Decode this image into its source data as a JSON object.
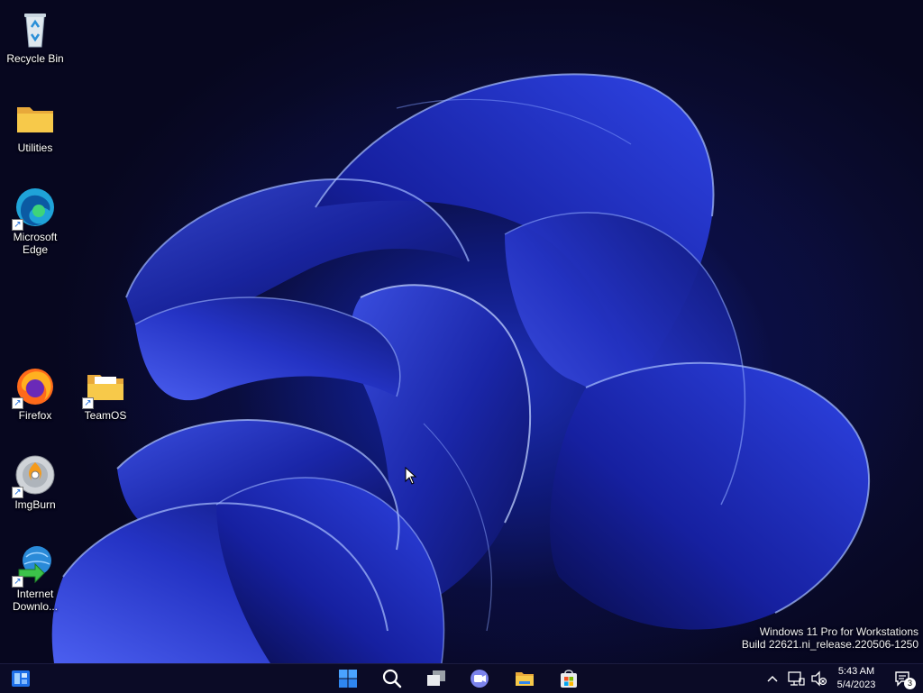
{
  "desktop": {
    "icons": [
      {
        "label": "Recycle Bin",
        "icon": "recycle-bin-icon"
      },
      {
        "label": "Utilities",
        "icon": "folder-icon"
      },
      {
        "label": "Microsoft\nEdge",
        "icon": "edge-icon"
      },
      {
        "label": "Firefox",
        "icon": "firefox-icon"
      },
      {
        "label": "TeamOS",
        "icon": "folder-icon"
      },
      {
        "label": "ImgBurn",
        "icon": "imgburn-icon"
      },
      {
        "label": "Internet\nDownlo...",
        "icon": "internet-download-manager-icon"
      }
    ],
    "watermark": {
      "line1": "Windows 11 Pro for Workstations",
      "line2": "Build 22621.ni_release.220506-1250"
    }
  },
  "taskbar": {
    "items": [
      {
        "name": "widgets",
        "icon": "widgets-icon"
      },
      {
        "name": "start",
        "icon": "windows-start-icon"
      },
      {
        "name": "search",
        "icon": "search-icon"
      },
      {
        "name": "task-view",
        "icon": "task-view-icon"
      },
      {
        "name": "teams-chat",
        "icon": "teams-chat-icon"
      },
      {
        "name": "file-explorer",
        "icon": "file-explorer-icon"
      },
      {
        "name": "microsoft-store",
        "icon": "store-icon"
      }
    ],
    "tray": {
      "time": "5:43 AM",
      "date": "5/4/2023",
      "notification_count": "3"
    }
  },
  "colors": {
    "taskbar_bg": "#0b0b26",
    "accent_blue": "#1e6fe8",
    "wallpaper_blue": "#1e2fb8"
  }
}
